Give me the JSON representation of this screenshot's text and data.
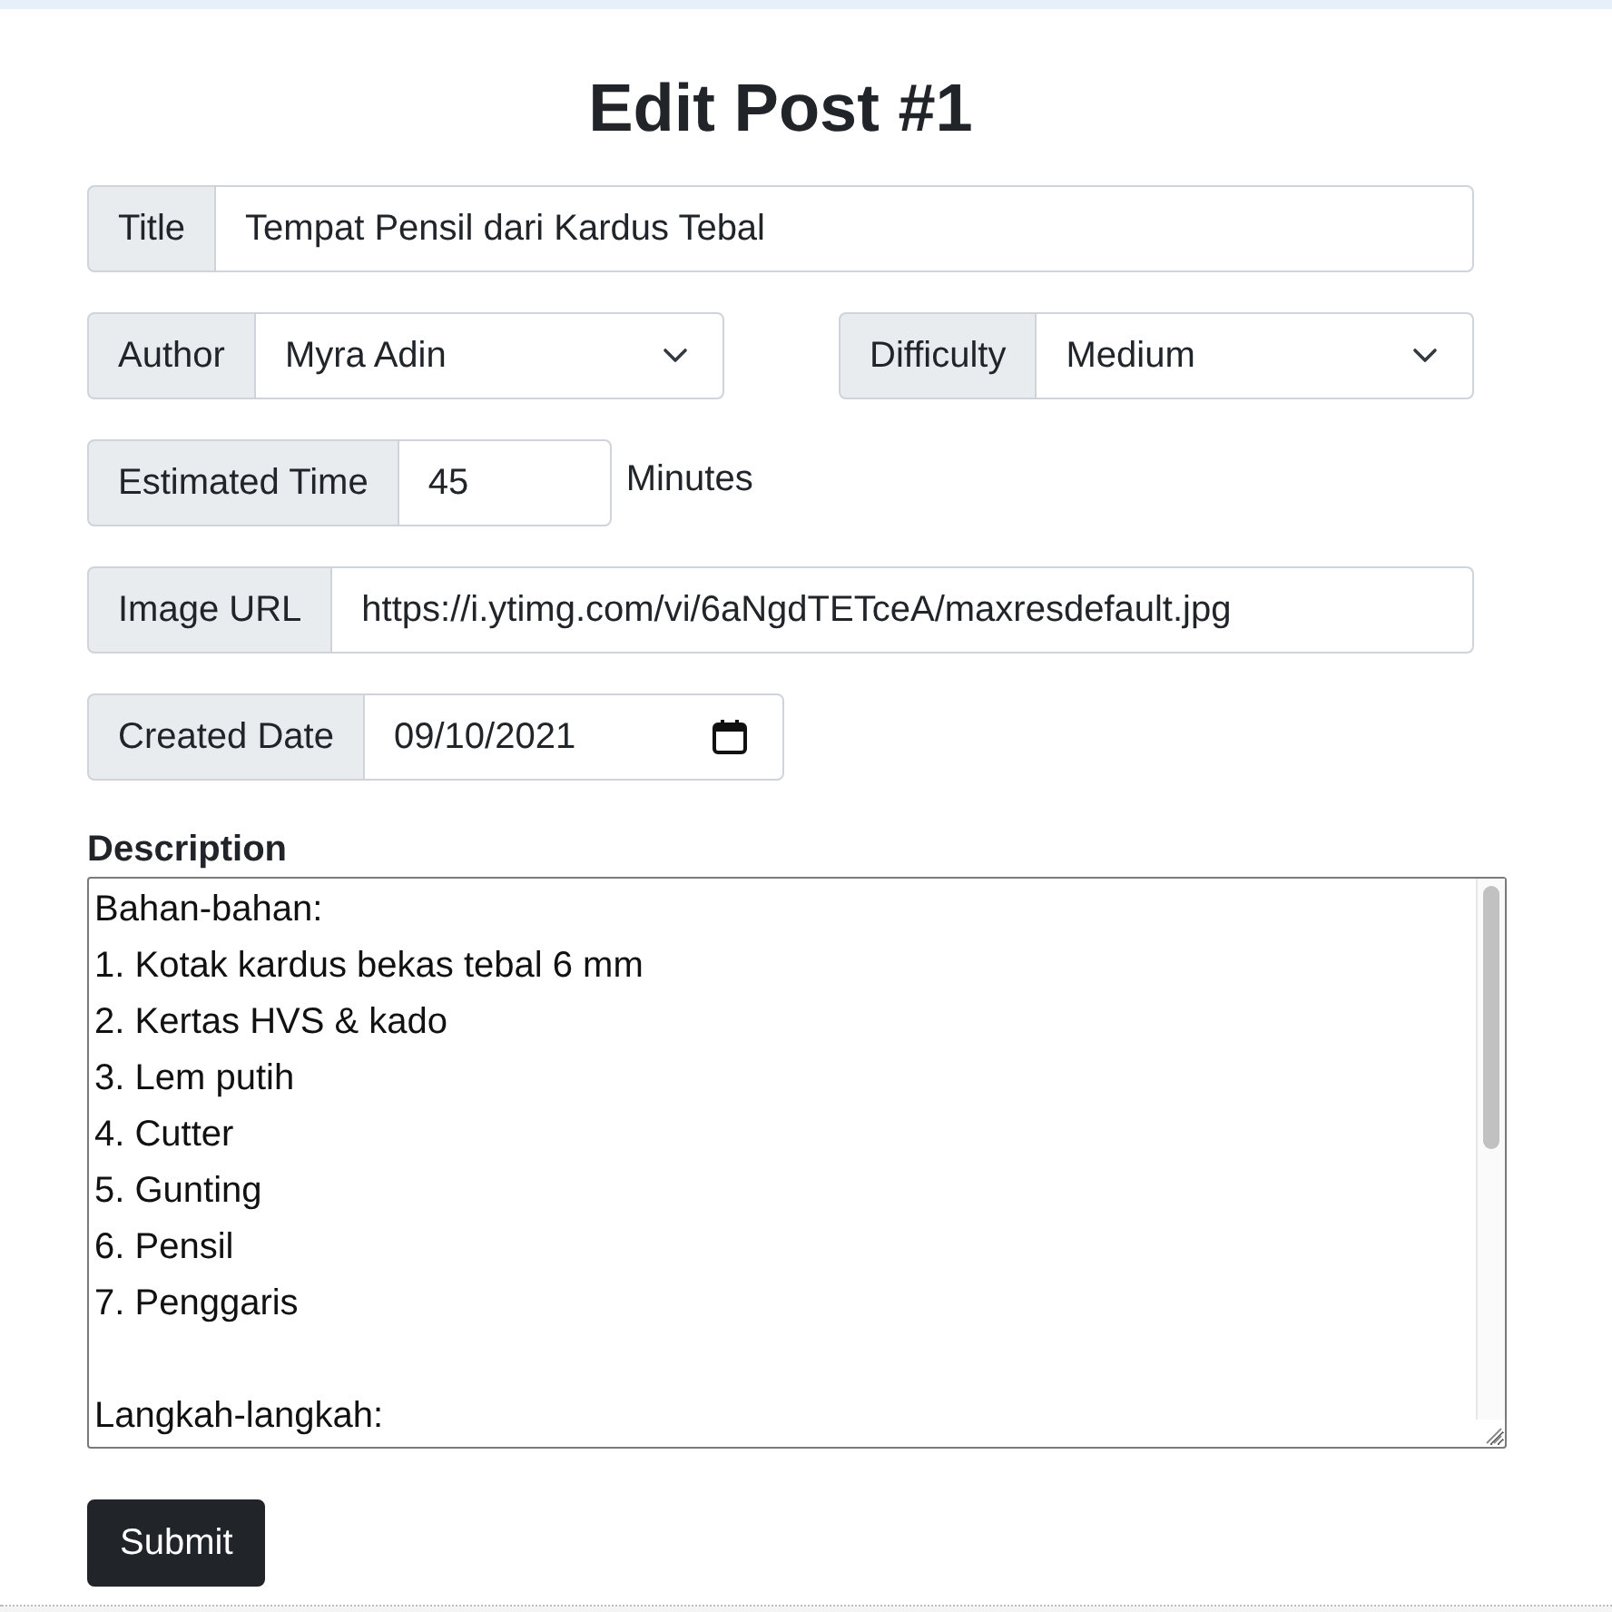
{
  "heading": "Edit Post #1",
  "rows": [
    {
      "fields": [
        {
          "kind": "text",
          "label": "Title",
          "value": "Tempat Pensil dari Kardus Tebal"
        }
      ]
    },
    {
      "fields": [
        {
          "kind": "select",
          "label": "Author",
          "value": "Myra Adin"
        },
        {
          "kind": "select",
          "label": "Difficulty",
          "value": "Medium"
        }
      ]
    },
    {
      "fields": [
        {
          "kind": "number",
          "label": "Estimated Time",
          "value": "45",
          "suffix": "Minutes"
        }
      ]
    },
    {
      "fields": [
        {
          "kind": "text",
          "label": "Image URL",
          "value": "https://i.ytimg.com/vi/6aNgdTETceA/maxresdefault.jpg"
        }
      ]
    },
    {
      "fields": [
        {
          "kind": "date",
          "label": "Created Date",
          "value": "09/10/2021"
        }
      ]
    }
  ],
  "description": {
    "label": "Description",
    "value": "Bahan-bahan:\n1. Kotak kardus bekas tebal 6 mm\n2. Kertas HVS & kado\n3. Lem putih\n4. Cutter\n5. Gunting\n6. Pensil\n7. Penggaris\n\nLangkah-langkah:"
  },
  "submit_button": "Submit"
}
